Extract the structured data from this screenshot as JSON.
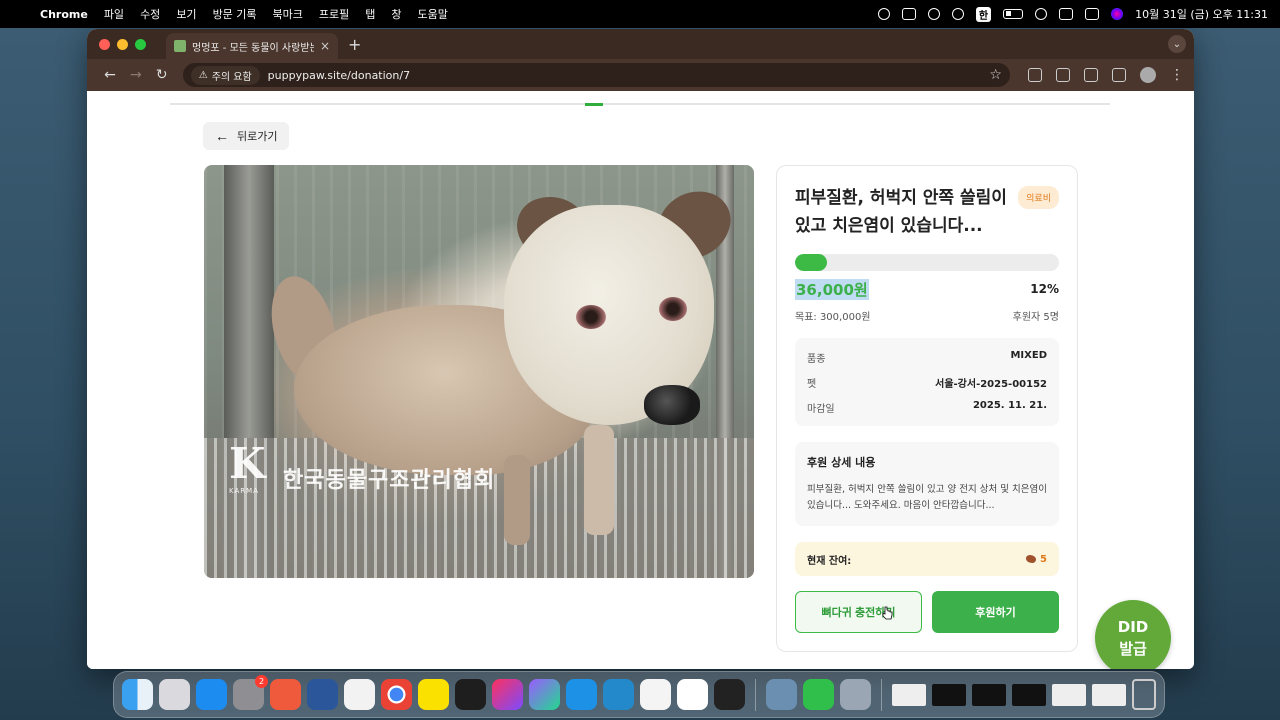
{
  "menubar": {
    "app_name": "Chrome",
    "items": [
      "파일",
      "수정",
      "보기",
      "방문 기록",
      "북마크",
      "프로필",
      "탭",
      "창",
      "도움말"
    ],
    "input_indicator": "한",
    "datetime": "10월 31일 (금) 오후 11:31"
  },
  "browser": {
    "tab_title": "멍멍포 - 모든 동물이 사랑받는 세상",
    "security_label": "주의 요함",
    "url": "puppypaw.site/donation/7"
  },
  "page": {
    "back_label": "뒤로가기",
    "campaign": {
      "title": "피부질환, 허벅지 안쪽 쓸림이 있고 치은염이 있습니다...",
      "category_badge": "의료비",
      "raised": "36,000원",
      "percent_label": "12%",
      "progress_fraction": 0.12,
      "goal": "목표: 300,000원",
      "backers": "후원자 5명",
      "info": [
        {
          "key": "품종",
          "value": "MIXED"
        },
        {
          "key": "펫",
          "value": "서울-강서-2025-00152"
        },
        {
          "key": "마감일",
          "value": "2025. 11. 21."
        }
      ],
      "detail_heading": "후원 상세 내용",
      "detail_text": "피부질환, 허벅지 안쪽 쓸림이 있고 양 전지 상처 및 치은염이 있습니다... 도와주세요. 마음이 안타깝습니다...",
      "balance_label": "현재 잔여:",
      "balance_value": "5",
      "charge_button": "뼈다귀 충전하기",
      "donate_button": "후원하기"
    },
    "photo_watermark": {
      "logo_letter": "K",
      "logo_text": "KARMA",
      "org": "한국동물구조관리협회"
    },
    "did_button": {
      "line1": "DID",
      "line2": "발급"
    }
  },
  "dock": {
    "settings_badge": "2"
  },
  "colors": {
    "brand_green": "#3cb04a",
    "badge_orange": "#e07b1a"
  }
}
